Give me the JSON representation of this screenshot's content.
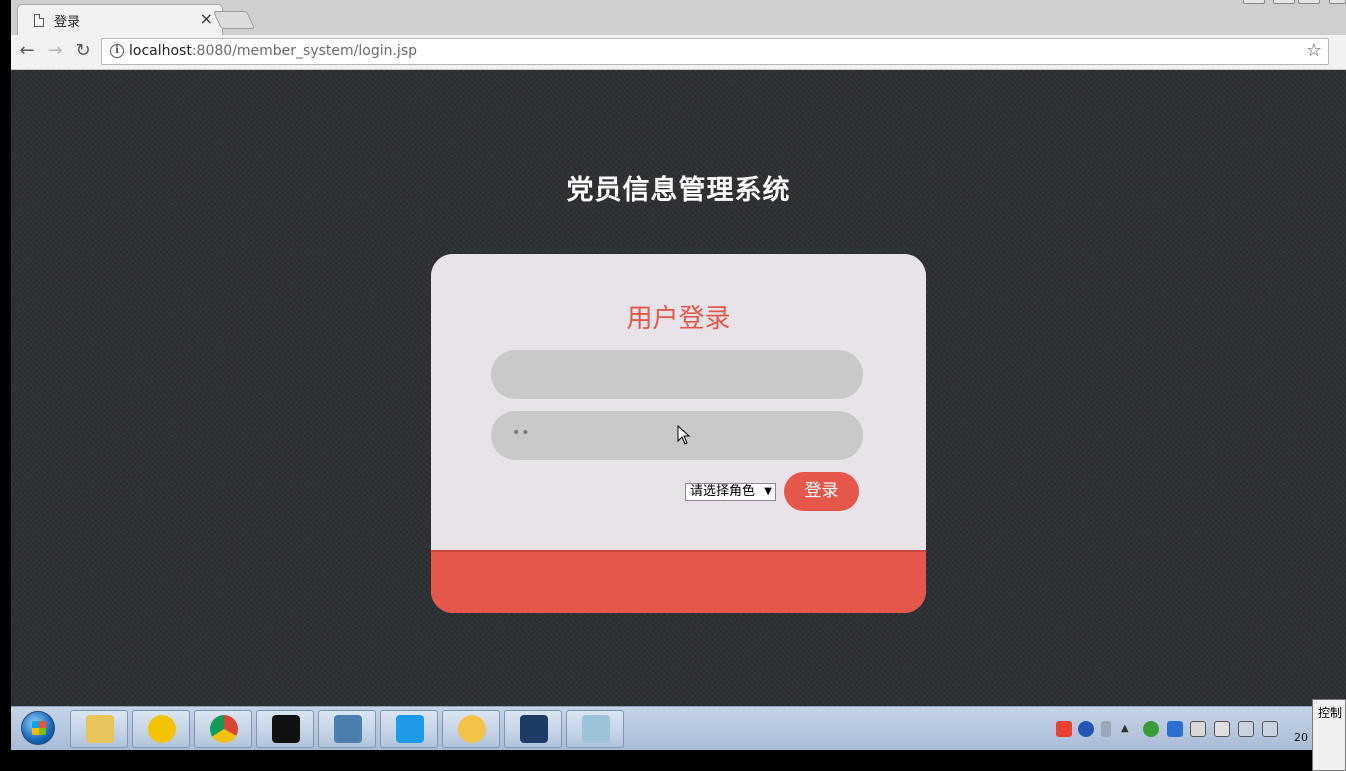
{
  "browser": {
    "tab_title": "登录",
    "tab_close": "×",
    "url_host": "localhost",
    "url_rest": ":8080/member_system/login.jsp",
    "back": "←",
    "forward": "→",
    "reload": "↻",
    "info": "i",
    "bookmark_star": "☆"
  },
  "page": {
    "system_title": "党员信息管理系统",
    "login_heading": "用户登录",
    "username_value": "",
    "password_value": "••",
    "role_select_value": "请选择角色",
    "role_select_arrow": "▼",
    "login_button": "登录"
  },
  "taskbar": {
    "apps": [
      {
        "name": "file-explorer-icon",
        "color": "#e8c55a"
      },
      {
        "name": "music-player-icon",
        "color": "#f5c400"
      },
      {
        "name": "chrome-icon",
        "color": "#db4437"
      },
      {
        "name": "command-prompt-icon",
        "color": "#111111"
      },
      {
        "name": "image-viewer-icon",
        "color": "#4a7fb0"
      },
      {
        "name": "wps-icon",
        "color": "#1e9be8"
      },
      {
        "name": "chat-app-icon",
        "color": "#f3c248"
      },
      {
        "name": "eclipse-like-icon",
        "color": "#1c3c66"
      },
      {
        "name": "notepad-icon",
        "color": "#9cc3d9"
      }
    ],
    "clock": "20",
    "panel_title": "控制"
  },
  "colors": {
    "accent": "#e5574b",
    "card_bg": "#e8e3e8",
    "page_bg": "#2b2e31"
  }
}
